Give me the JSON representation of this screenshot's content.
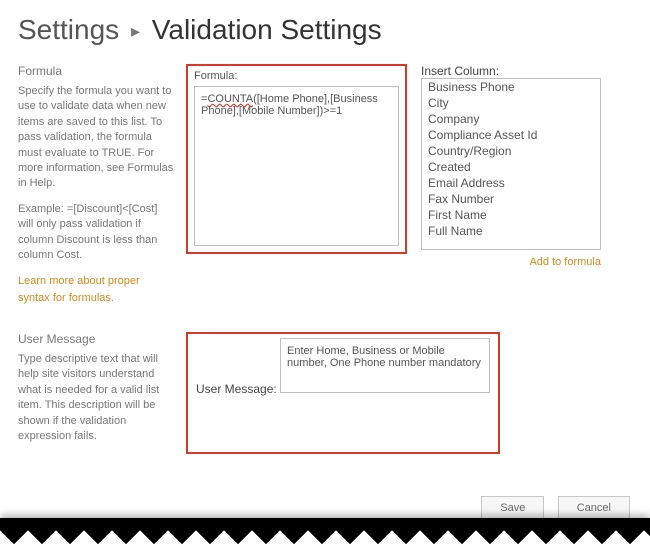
{
  "breadcrumb": {
    "root": "Settings",
    "sep": "▸",
    "current": "Validation Settings"
  },
  "formula_section": {
    "heading": "Formula",
    "desc1": "Specify the formula you want to use to validate data when new items are saved to this list. To pass validation, the formula must evaluate to TRUE. For more information, see Formulas in Help.",
    "desc2": "Example: =[Discount]<[Cost] will only pass validation if column Discount is less than column Cost.",
    "learn_link": "Learn more about proper syntax for formulas.",
    "formula_label": "Formula:",
    "formula_prefix": "=",
    "formula_func": "COUNTA",
    "formula_rest": "([Home Phone],[Business Phone],[Mobile Number])>=1",
    "insert_label": "Insert Column:",
    "columns": [
      "Business Phone",
      "City",
      "Company",
      "Compliance Asset Id",
      "Country/Region",
      "Created",
      "Email Address",
      "Fax Number",
      "First Name",
      "Full Name"
    ],
    "add_link": "Add to formula"
  },
  "msg_section": {
    "heading": "User Message",
    "desc": "Type descriptive text that will help site visitors understand what is needed for a valid list item. This description will be shown if the validation expression fails.",
    "label": "User Message:",
    "value": "Enter Home, Business or Mobile number, One Phone number mandatory"
  },
  "buttons": {
    "save": "Save",
    "cancel": "Cancel"
  }
}
